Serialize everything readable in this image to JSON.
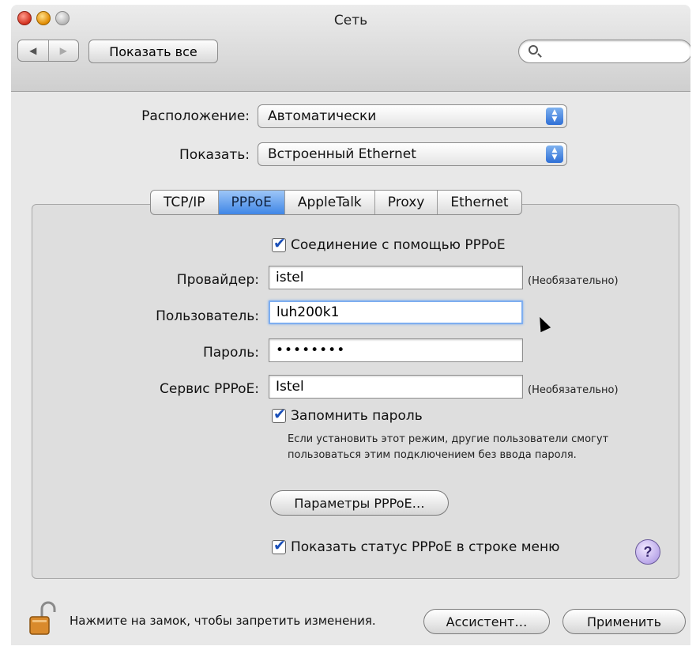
{
  "window": {
    "title": "Сеть"
  },
  "toolbar": {
    "back_icon": "◀",
    "forward_icon": "▶",
    "show_all_label": "Показать все",
    "search_placeholder": ""
  },
  "location": {
    "label": "Расположение:",
    "value": "Автоматически"
  },
  "show": {
    "label": "Показать:",
    "value": "Встроенный Ethernet"
  },
  "tabs": [
    {
      "label": "TCP/IP",
      "active": false
    },
    {
      "label": "PPPoE",
      "active": true
    },
    {
      "label": "AppleTalk",
      "active": false
    },
    {
      "label": "Proxy",
      "active": false
    },
    {
      "label": "Ethernet",
      "active": false
    }
  ],
  "pppoe": {
    "connect_check_label": "Соединение с помощью PPPoE",
    "provider": {
      "label": "Провайдер:",
      "value": "istel",
      "hint": "(Необязательно)"
    },
    "user": {
      "label": "Пользователь:",
      "value": "luh200k1"
    },
    "password": {
      "label": "Пароль:",
      "value": "••••••••"
    },
    "service": {
      "label": "Сервис PPPoE:",
      "value": "Istel",
      "hint": "(Необязательно)"
    },
    "remember_label": "Запомнить пароль",
    "remember_description": "Если установить этот режим, другие пользователи смогут пользоваться этим подключением без ввода пароля.",
    "options_button": "Параметры PPPoE…",
    "status_check_label": "Показать статус PPPoE в строке меню",
    "help_label": "?"
  },
  "footer": {
    "lock_text": "Нажмите на замок, чтобы запретить изменения.",
    "assistant_button": "Ассистент…",
    "apply_button": "Применить"
  },
  "colors": {
    "accent": "#3f86e6",
    "window_bg": "#e8e8e8"
  }
}
